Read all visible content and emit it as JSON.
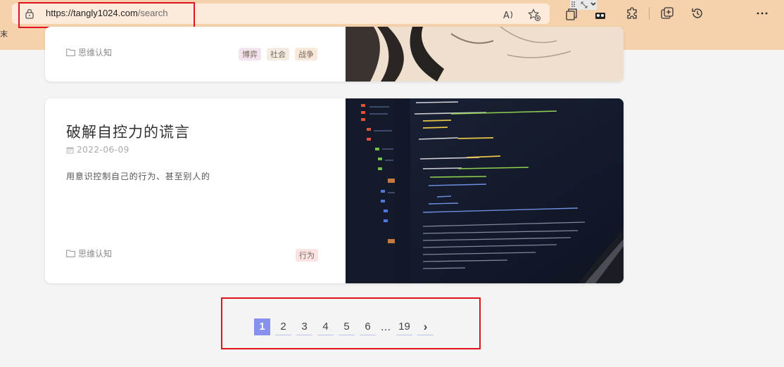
{
  "browser": {
    "url_host": "https://tangly1024.com",
    "url_path": "/search",
    "side_char": "末",
    "icons": [
      "lock-icon",
      "read-aloud-icon",
      "favorite-add-icon",
      "qr-icon",
      "screenshot-icon",
      "extensions-icon",
      "collections-icon",
      "history-icon",
      "more-icon"
    ]
  },
  "cards": [
    {
      "category": "思维认知",
      "tags": [
        "博弈",
        "社会",
        "战争"
      ]
    },
    {
      "title": "破解自控力的谎言",
      "date": "2022-06-09",
      "excerpt": "用意识控制自己的行为、甚至别人的",
      "category": "思维认知",
      "tags": [
        "行为"
      ]
    }
  ],
  "pagination": {
    "pages": [
      "1",
      "2",
      "3",
      "4",
      "5",
      "6"
    ],
    "ellipsis": "...",
    "last": "19",
    "next": "›",
    "current": "1"
  },
  "colors": {
    "chrome": "#f6d2ac",
    "accent": "#8790ed",
    "highlight": "#e0141e"
  }
}
